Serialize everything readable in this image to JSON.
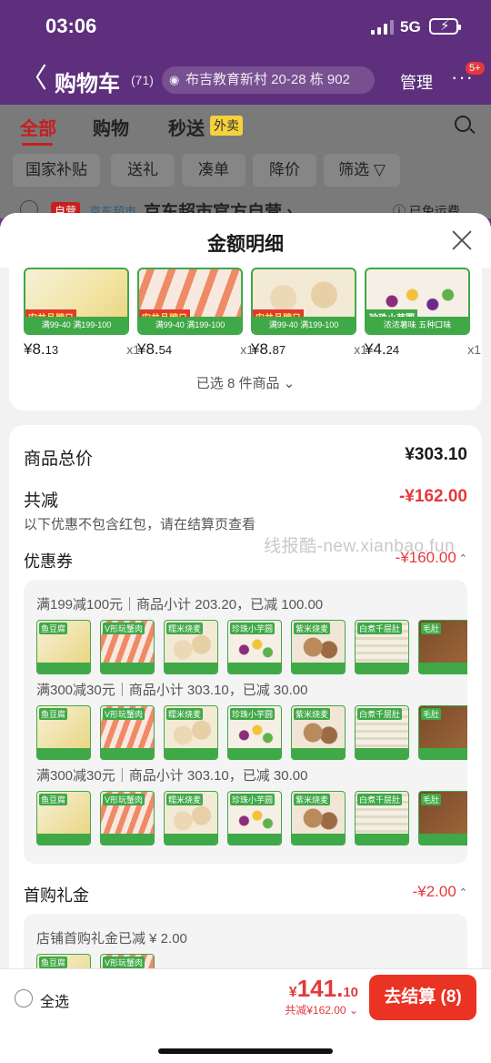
{
  "status_bar": {
    "time": "03:06",
    "network": "5G"
  },
  "nav": {
    "back": "〈",
    "title": "购物车",
    "count": "(71)",
    "address": "布吉教育新村 20-28 栋 902",
    "manage": "管理",
    "more": "···",
    "badge": "5+"
  },
  "tabs": [
    {
      "label": "全部"
    },
    {
      "label": "购物"
    },
    {
      "label": "秒送"
    }
  ],
  "tab_tag": "外卖",
  "filters": [
    {
      "label": "国家补贴"
    },
    {
      "label": "送礼"
    },
    {
      "label": "凑单"
    },
    {
      "label": "降价"
    },
    {
      "label": "筛选 ▽"
    }
  ],
  "store": {
    "self_tag": "自营",
    "jd_tag": "京东超市",
    "name": "京东超市官方自营 ›",
    "shipping": "ⓘ 已免运费"
  },
  "sheet": {
    "title": "金额明细",
    "items": [
      {
        "price_int": "¥8.",
        "price_dec": "13",
        "qty": "x1",
        "cap": "满99-40 满199-100",
        "tag": "安井品牌日"
      },
      {
        "price_int": "¥8.",
        "price_dec": "54",
        "qty": "x1",
        "cap": "满99-40 满199-100",
        "tag": "安井品牌日"
      },
      {
        "price_int": "¥8.",
        "price_dec": "87",
        "qty": "x1",
        "cap": "满99-40 满199-100",
        "tag": "安井品牌日"
      },
      {
        "price_int": "¥4.",
        "price_dec": "24",
        "qty": "x1",
        "cap": "浓浓薯味 五种口味",
        "tag": "珍珠小芋圆"
      }
    ],
    "selected_label": "已选 8 件商品 ⌄",
    "total_label": "商品总价",
    "total_value": "¥303.10",
    "discount_label": "共减",
    "discount_value": "-¥162.00",
    "discount_note": "以下优惠不包含红包，请在结算页查看",
    "watermark": "线报酷-new.xianbao.fun",
    "coupon_label": "优惠券",
    "coupon_value": "-¥160.00",
    "coupons": [
      {
        "text": "满199减100元｜商品小计 203.20，已减 100.00"
      },
      {
        "text": "满300减30元｜商品小计 303.10，已减 30.00"
      },
      {
        "text": "满300减30元｜商品小计 303.10，已减 30.00"
      }
    ],
    "thumb_labels": [
      "鱼豆腐",
      "V形玩蟹肉",
      "糯米烧麦",
      "珍珠小芋圆",
      "紫米烧麦",
      "白煮千层肚",
      "毛肚"
    ],
    "gift_label": "首购礼金",
    "gift_value": "-¥2.00",
    "gift_note": "店铺首购礼金已减 ¥ 2.00"
  },
  "bottom": {
    "select_all": "全选",
    "currency": "¥",
    "amount_int": "141.",
    "amount_dec": "10",
    "saved": "共减¥162.00 ⌄",
    "checkout": "去结算 (8)"
  },
  "colors": {
    "accent": "#e4393c",
    "header_purple": "#5e2f7c",
    "checkout": "#ea3323",
    "product_green": "#3fa847"
  }
}
